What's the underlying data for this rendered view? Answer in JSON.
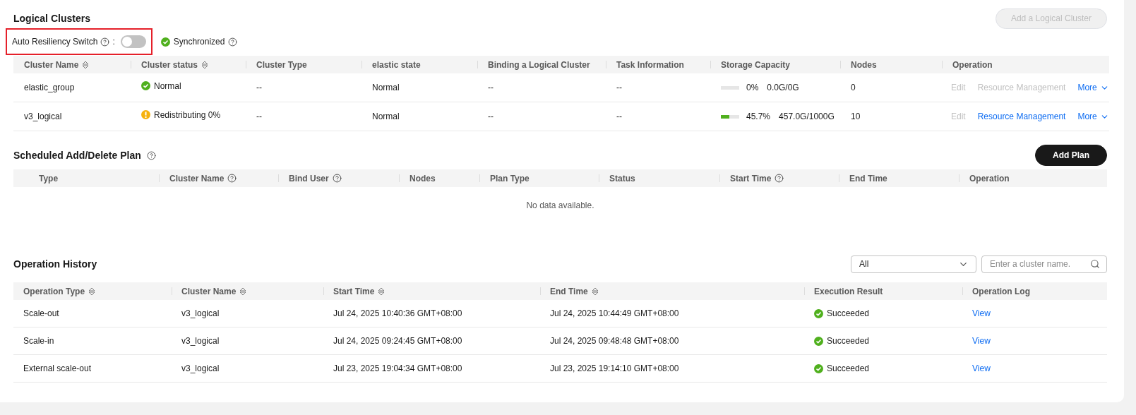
{
  "logical_clusters": {
    "title": "Logical Clusters",
    "add_button": {
      "label": "Add a Logical Cluster",
      "disabled": true
    },
    "auto_resiliency": {
      "label": "Auto Resiliency Switch",
      "separator": ":",
      "on": false,
      "highlighted": true
    },
    "sync_status": {
      "label": "Synchronized",
      "kind": "success"
    },
    "columns": [
      {
        "label": "Cluster Name",
        "sortable": true
      },
      {
        "label": "Cluster status",
        "sortable": true
      },
      {
        "label": "Cluster Type",
        "sortable": false
      },
      {
        "label": "elastic state",
        "sortable": false
      },
      {
        "label": "Binding a Logical Cluster",
        "sortable": false
      },
      {
        "label": "Task Information",
        "sortable": false
      },
      {
        "label": "Storage Capacity",
        "sortable": false
      },
      {
        "label": "Nodes",
        "sortable": false
      },
      {
        "label": "Operation",
        "sortable": false
      }
    ],
    "rows": [
      {
        "name": "elastic_group",
        "status": {
          "label": "Normal",
          "kind": "success"
        },
        "type": "--",
        "elastic_state": "Normal",
        "binding": "--",
        "task": "--",
        "storage": {
          "level": 0,
          "percent": "0%",
          "usage": "0.0G/0G"
        },
        "nodes": "0",
        "operations": [
          {
            "label": "Edit",
            "disabled": true
          },
          {
            "label": "Resource Management",
            "disabled": true
          }
        ],
        "more": "More"
      },
      {
        "name": "v3_logical",
        "status": {
          "label": "Redistributing 0%",
          "kind": "warning"
        },
        "type": "--",
        "elastic_state": "Normal",
        "binding": "--",
        "task": "--",
        "storage": {
          "level": 0.457,
          "percent": "45.7%",
          "usage": "457.0G/1000G"
        },
        "nodes": "10",
        "operations": [
          {
            "label": "Edit",
            "disabled": true
          },
          {
            "label": "Resource Management",
            "disabled": false
          }
        ],
        "more": "More"
      }
    ]
  },
  "scheduled_plan": {
    "title": "Scheduled Add/Delete Plan",
    "add_button": {
      "label": "Add Plan",
      "disabled": false
    },
    "columns": [
      {
        "label": "Type",
        "help": false
      },
      {
        "label": "Cluster Name",
        "help": true
      },
      {
        "label": "Bind User",
        "help": true
      },
      {
        "label": "Nodes",
        "help": false
      },
      {
        "label": "Plan Type",
        "help": false
      },
      {
        "label": "Status",
        "help": false
      },
      {
        "label": "Start Time",
        "help": true
      },
      {
        "label": "End Time",
        "help": false
      },
      {
        "label": "Operation",
        "help": false
      }
    ],
    "empty_text": "No data available."
  },
  "operation_history": {
    "title": "Operation History",
    "filter": {
      "value": "All"
    },
    "search": {
      "placeholder": "Enter a cluster name."
    },
    "columns": [
      {
        "label": "Operation Type",
        "sortable": true
      },
      {
        "label": "Cluster Name",
        "sortable": true
      },
      {
        "label": "Start Time",
        "sortable": true
      },
      {
        "label": "End Time",
        "sortable": true
      },
      {
        "label": "Execution Result",
        "sortable": false
      },
      {
        "label": "Operation Log",
        "sortable": false
      }
    ],
    "rows": [
      {
        "operation_type": "Scale-out",
        "cluster_name": "v3_logical",
        "start_time": "Jul 24, 2025 10:40:36 GMT+08:00",
        "end_time": "Jul 24, 2025 10:44:49 GMT+08:00",
        "result": {
          "label": "Succeeded",
          "kind": "success"
        },
        "log": "View"
      },
      {
        "operation_type": "Scale-in",
        "cluster_name": "v3_logical",
        "start_time": "Jul 24, 2025 09:24:45 GMT+08:00",
        "end_time": "Jul 24, 2025 09:48:48 GMT+08:00",
        "result": {
          "label": "Succeeded",
          "kind": "success"
        },
        "log": "View"
      },
      {
        "operation_type": "External scale-out",
        "cluster_name": "v3_logical",
        "start_time": "Jul 23, 2025 19:04:34 GMT+08:00",
        "end_time": "Jul 23, 2025 19:14:10 GMT+08:00",
        "result": {
          "label": "Succeeded",
          "kind": "success"
        },
        "log": "View"
      }
    ]
  }
}
